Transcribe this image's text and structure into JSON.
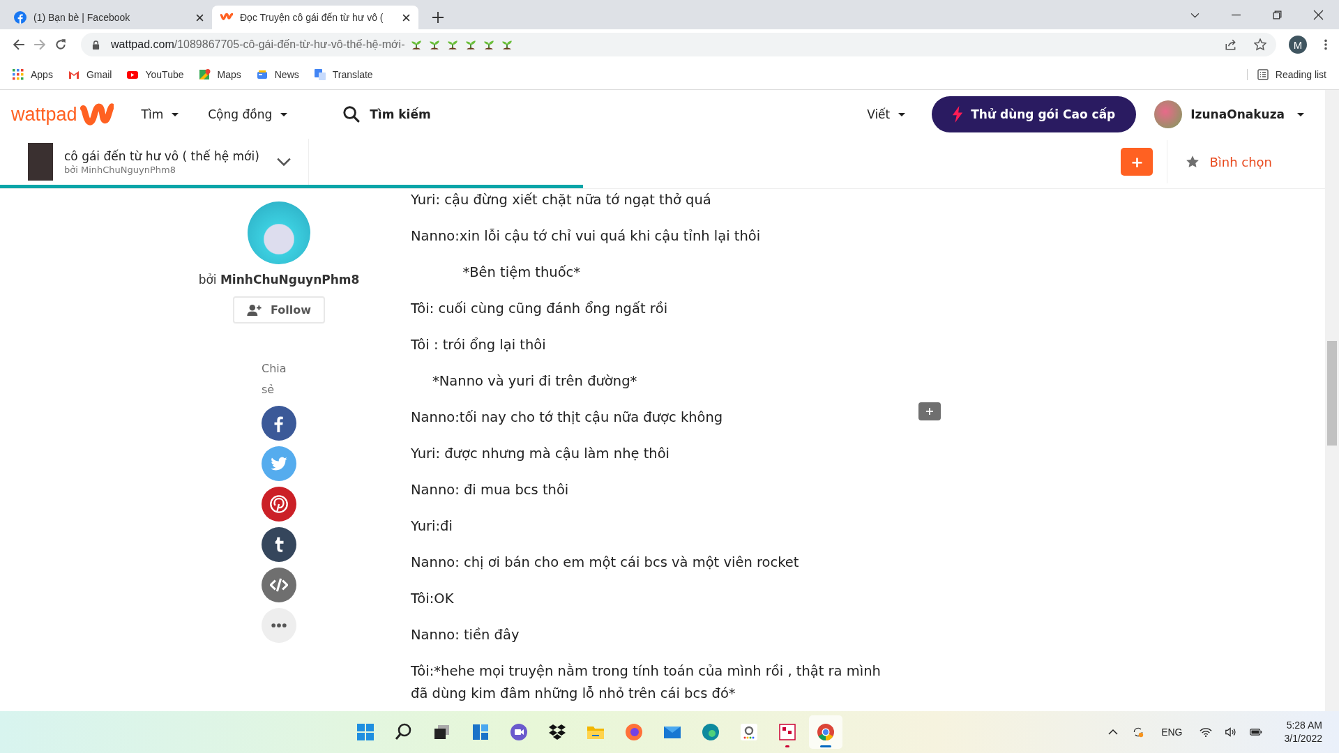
{
  "browser": {
    "tabs": [
      {
        "title": "(1) Bạn bè | Facebook",
        "selected": false
      },
      {
        "title": "Đọc Truyện cô gái đến từ hư vô (",
        "selected": true
      }
    ],
    "address": {
      "host": "wattpad.com",
      "path": "/1089867705-cô-gái-đến-từ-hư-vô-thế-hệ-mới-"
    },
    "profile_initial": "M",
    "bookmarks": [
      {
        "label": "Apps"
      },
      {
        "label": "Gmail"
      },
      {
        "label": "YouTube"
      },
      {
        "label": "Maps"
      },
      {
        "label": "News"
      },
      {
        "label": "Translate"
      }
    ],
    "reading_list": "Reading list"
  },
  "header": {
    "logo": "wattpad",
    "nav": [
      "Tìm",
      "Cộng đồng"
    ],
    "search": "Tìm kiếm",
    "write": "Viết",
    "premium": "Thử dùng gói Cao cấp",
    "username": "IzunaOnakuza"
  },
  "story_bar": {
    "title": "cô gái đến từ hư vô ( thế hệ mới)",
    "author": "bởi MinhChuNguynPhm8",
    "add": "+",
    "vote": "Bình chọn",
    "progress": {
      "level": 0.44
    }
  },
  "author": {
    "by": "bởi",
    "name": "MinhChuNguynPhm8",
    "follow": "Follow"
  },
  "share": {
    "label": "Chia sẻ",
    "buttons": [
      {
        "kind": "facebook"
      },
      {
        "kind": "twitter"
      },
      {
        "kind": "pinterest"
      },
      {
        "kind": "tumblr"
      },
      {
        "kind": "embed"
      },
      {
        "kind": "more"
      }
    ]
  },
  "paragraphs": [
    "Yuri: cậu đừng xiết chặt nữa tớ ngạt thở quá",
    "Nanno:xin lỗi cậu tớ chỉ vui quá khi cậu tỉnh lại thôi",
    "            *Bên tiệm thuốc*",
    "Tôi: cuối cùng cũng đánh ổng ngất rồi",
    "Tôi : trói ổng lại thôi",
    "     *Nanno và yuri đi trên đường*",
    "Nanno:tối nay cho tớ thịt cậu nữa được không",
    "Yuri: được nhưng mà cậu làm nhẹ thôi",
    "Nanno: đi mua bcs thôi",
    "Yuri:đi",
    "Nanno: chị ơi bán cho em một cái bcs và một viên rocket",
    "Tôi:OK",
    "Nanno: tiền đây",
    "Tôi:*hehe mọi truyện nằm trong tính toán của mình rồi , thật ra mình đã dùng kim đâm những lỗ nhỏ trên cái bcs đó*"
  ],
  "comment_button": "+",
  "taskbar": {
    "apps": [
      {
        "kind": "start",
        "running": false,
        "selected": false
      },
      {
        "kind": "search",
        "running": false,
        "selected": false
      },
      {
        "kind": "taskview",
        "running": false,
        "selected": false
      },
      {
        "kind": "widgets",
        "running": false,
        "selected": false
      },
      {
        "kind": "chat",
        "running": false,
        "selected": false
      },
      {
        "kind": "dropbox",
        "running": false,
        "selected": false
      },
      {
        "kind": "files",
        "running": false,
        "selected": false
      },
      {
        "kind": "firefox",
        "running": false,
        "selected": false
      },
      {
        "kind": "mail",
        "running": false,
        "selected": false
      },
      {
        "kind": "edge",
        "running": false,
        "selected": false
      },
      {
        "kind": "amazon",
        "running": false,
        "selected": false
      },
      {
        "kind": "tool",
        "running": true,
        "selected": false
      },
      {
        "kind": "chrome",
        "running": true,
        "selected": true
      }
    ],
    "language": "ENG",
    "time": "5:28 AM",
    "date": "3/1/2022"
  }
}
